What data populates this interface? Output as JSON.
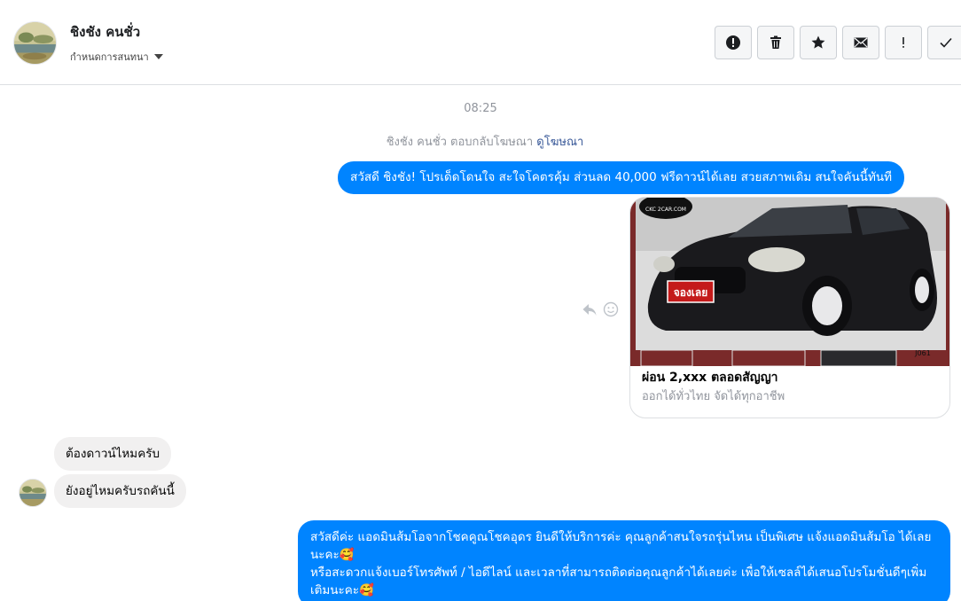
{
  "contact": {
    "name": "ชิงชัง คนชั่ว",
    "subtitle": "กำหนดการสนทนา"
  },
  "toolbar": {
    "actions": [
      "alert-icon",
      "trash-icon",
      "star-icon",
      "envelope-icon",
      "exclamation-icon",
      "check-icon"
    ]
  },
  "thread": {
    "timestamp": "08:25",
    "reply_note_prefix": "ชิงชัง คนชั่ว ตอบกลับโฆษณา",
    "reply_note_link": "ดูโฆษณา",
    "msg_outgoing_1": "สวัสดี ชิงชัง! โปรเด็ดโดนใจ สะใจโคตรคุ้ม ส่วนลด 40,000 ฟรีดาวน์ได้เลย สวยสภาพเดิม สนใจคันนี้ทันที",
    "ad": {
      "watermark": "CKC 2CAR.COM",
      "badge": "จองเลย",
      "code": "J061",
      "title": "ผ่อน 2,xxx ตลอดสัญญา",
      "subtitle": "ออกได้ทั่วไทย จัดได้ทุกอาชีพ"
    },
    "msg_incoming_1": "ต้องดาวน์ไหมครับ",
    "msg_incoming_2": "ยังอยู่ไหมครับรถคันนี้",
    "msg_outgoing_2_line1": "สวัสดีค่ะ แอดมินส้มโอจากโชคคูณโชคอุดร ยินดีให้บริการค่ะ  คุณลูกค้าสนใจรถรุ่นไหน เป็นพิเศษ แจ้งแอดมินส้มโอ ได้เลยนะคะ🥰",
    "msg_outgoing_2_line2": "หรือสะดวกแจ้งเบอร์โทรศัพท์ / ไอดีไลน์ และเวลาที่สามารถติดต่อคุณลูกค้าได้เลยค่ะ เพื่อให้เซลล์ได้เสนอโปรโมชั่นดีๆเพิ่มเติมนะคะ🥰"
  },
  "colors": {
    "accent_blue": "#0084ff",
    "incoming_gray": "#f1f0f0",
    "link_blue": "#385898"
  }
}
